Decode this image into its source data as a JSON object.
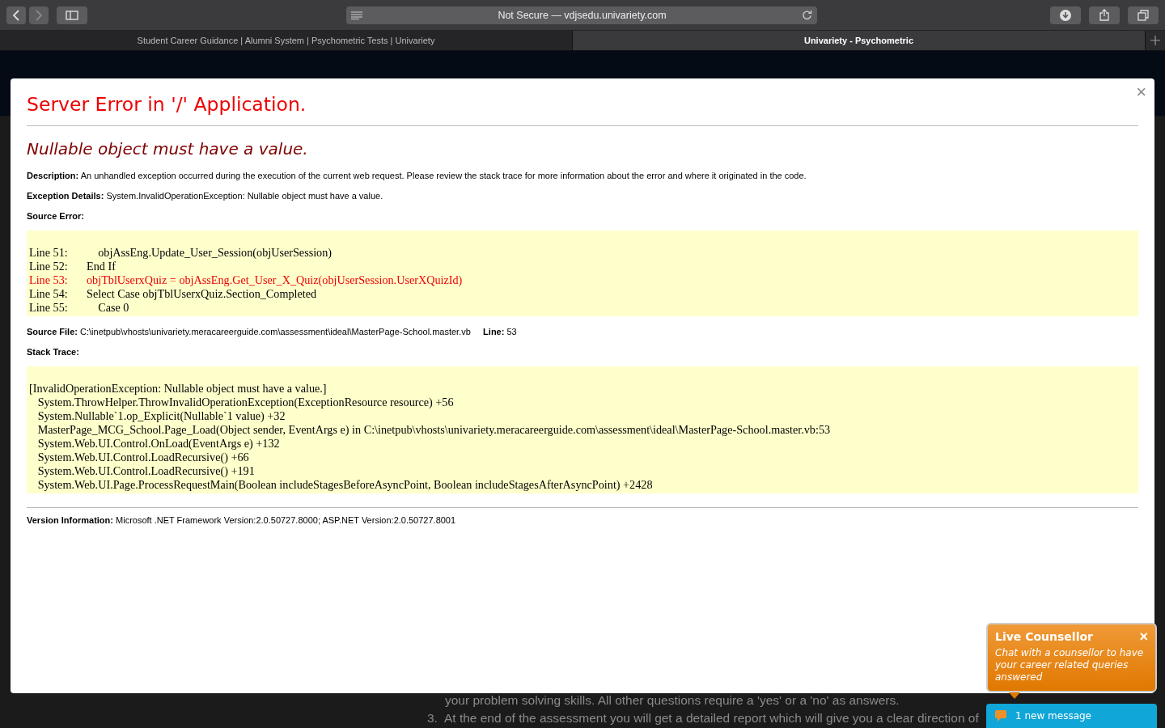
{
  "browser": {
    "address": "Not Secure — vdjsedu.univariety.com",
    "tabs": [
      {
        "label": "Student Career Guidance | Alumni System | Psychometric Tests | Univariety",
        "selected": false
      },
      {
        "label": "Univariety - Psychometric",
        "selected": true
      }
    ]
  },
  "background_page": {
    "lines": [
      {
        "text": "your problem solving skills. All other questions require a 'yes' or a 'no' as answers."
      },
      {
        "number": "3.",
        "text": "At the end of the assessment you will get a detailed report which will give you a clear direction of"
      }
    ]
  },
  "error": {
    "title": "Server Error in '/' Application.",
    "message": "Nullable object must have a value.",
    "fields": [
      {
        "label": "Description:",
        "value": "An unhandled exception occurred during the execution of the current web request. Please review the stack trace for more information about the error and where it originated in the code."
      },
      {
        "label": "Exception Details:",
        "value": "System.InvalidOperationException: Nullable object must have a value."
      }
    ],
    "source_error": {
      "label": "Source Error:",
      "lines": [
        {
          "number": "Line 51:",
          "code": "    objAssEng.Update_User_Session(objUserSession)",
          "highlighted": false
        },
        {
          "number": "Line 52:",
          "code": "End If",
          "highlighted": false
        },
        {
          "number": "Line 53:",
          "code": "objTblUserxQuiz = objAssEng.Get_User_X_Quiz(objUserSession.UserXQuizId)",
          "highlighted": true
        },
        {
          "number": "Line 54:",
          "code": "Select Case objTblUserxQuiz.Section_Completed",
          "highlighted": false
        },
        {
          "number": "Line 55:",
          "code": "    Case 0",
          "highlighted": false
        }
      ]
    },
    "source_file": {
      "label": "Source File:",
      "value": "C:\\inetpub\\vhosts\\univariety.meracareerguide.com\\assessment\\ideal\\MasterPage-School.master.vb",
      "line_label": "Line:",
      "line_value": "53"
    },
    "stack_trace": {
      "label": "Stack Trace:",
      "lines": [
        "[InvalidOperationException: Nullable object must have a value.]",
        "   System.ThrowHelper.ThrowInvalidOperationException(ExceptionResource resource) +56",
        "   System.Nullable`1.op_Explicit(Nullable`1 value) +32",
        "   MasterPage_MCG_School.Page_Load(Object sender, EventArgs e) in C:\\inetpub\\vhosts\\univariety.meracareerguide.com\\assessment\\ideal\\MasterPage-School.master.vb:53",
        "   System.Web.UI.Control.OnLoad(EventArgs e) +132",
        "   System.Web.UI.Control.LoadRecursive() +66",
        "   System.Web.UI.Control.LoadRecursive() +191",
        "   System.Web.UI.Page.ProcessRequestMain(Boolean includeStagesBeforeAsyncPoint, Boolean includeStagesAfterAsyncPoint) +2428"
      ]
    },
    "version": {
      "label": "Version Information:",
      "value": "Microsoft .NET Framework Version:2.0.50727.8000; ASP.NET Version:2.0.50727.8001"
    }
  },
  "chat": {
    "title": "Live Counsellor",
    "text": "Chat with a counsellor to have your career related queries answered",
    "close": "×",
    "bar": "1 new message"
  },
  "modal_close": "×"
}
